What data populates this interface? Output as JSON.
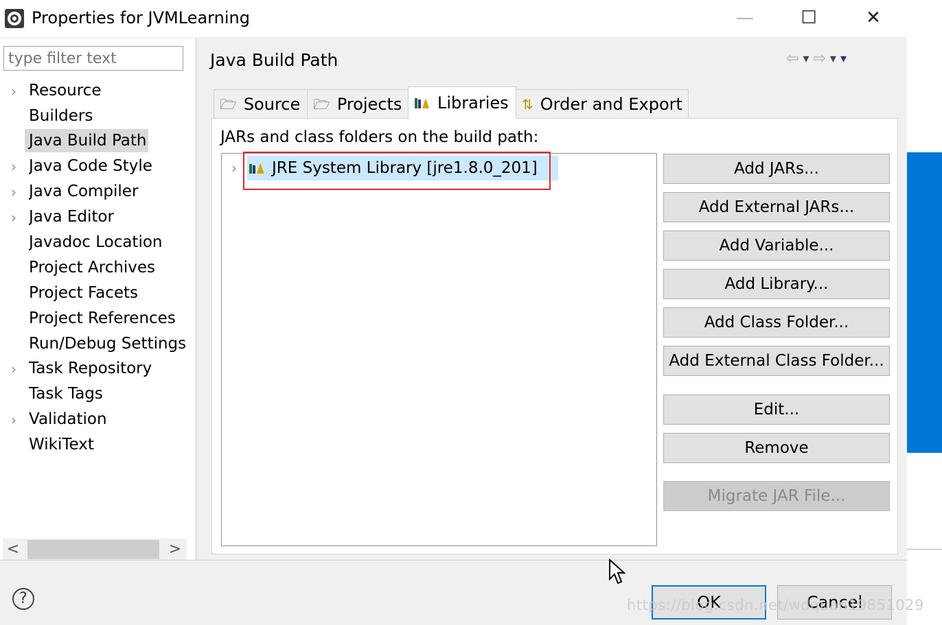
{
  "window": {
    "title": "Properties for JVMLearning",
    "minimize_glyph": "—",
    "maximize_glyph": "☐",
    "close_glyph": "✕"
  },
  "filter": {
    "placeholder": "type filter text"
  },
  "tree": {
    "items": [
      {
        "label": "Resource",
        "has_children": true
      },
      {
        "label": "Builders",
        "has_children": false
      },
      {
        "label": "Java Build Path",
        "has_children": false,
        "selected": true
      },
      {
        "label": "Java Code Style",
        "has_children": true
      },
      {
        "label": "Java Compiler",
        "has_children": true
      },
      {
        "label": "Java Editor",
        "has_children": true
      },
      {
        "label": "Javadoc Location",
        "has_children": false
      },
      {
        "label": "Project Archives",
        "has_children": false
      },
      {
        "label": "Project Facets",
        "has_children": false
      },
      {
        "label": "Project References",
        "has_children": false
      },
      {
        "label": "Run/Debug Settings",
        "has_children": false
      },
      {
        "label": "Task Repository",
        "has_children": true
      },
      {
        "label": "Task Tags",
        "has_children": false
      },
      {
        "label": "Validation",
        "has_children": true
      },
      {
        "label": "WikiText",
        "has_children": false
      }
    ],
    "scroll_left": "<",
    "scroll_right": ">"
  },
  "page": {
    "title": "Java Build Path",
    "tabs": [
      {
        "label": "Source",
        "icon": "source-icon"
      },
      {
        "label": "Projects",
        "icon": "projects-icon"
      },
      {
        "label": "Libraries",
        "icon": "libraries-icon",
        "active": true
      },
      {
        "label": "Order and Export",
        "icon": "order-export-icon"
      }
    ],
    "libraries_label": "JARs and class folders on the build path:",
    "libraries": [
      {
        "label": "JRE System Library [jre1.8.0_201]"
      }
    ],
    "buttons": {
      "add_jars": "Add JARs...",
      "add_external_jars": "Add External JARs...",
      "add_variable": "Add Variable...",
      "add_library": "Add Library...",
      "add_class_folder": "Add Class Folder...",
      "add_external_class_folder": "Add External Class Folder...",
      "edit": "Edit...",
      "remove": "Remove",
      "migrate_jar": "Migrate JAR File..."
    }
  },
  "footer": {
    "help": "?",
    "ok": "OK",
    "cancel": "Cancel"
  },
  "watermark": "https://blog.csdn.net/wdquan19851029",
  "colors": {
    "accent": "#0078d7",
    "selection": "#cce8ff",
    "highlight_box": "#e8262b"
  }
}
